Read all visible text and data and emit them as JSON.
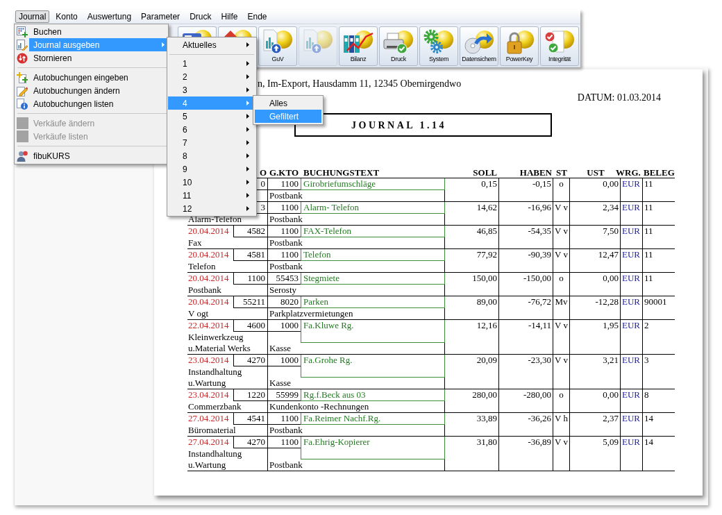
{
  "menubar": {
    "items": [
      {
        "label": "Journal",
        "selected": true
      },
      {
        "label": "Konto",
        "selected": false
      },
      {
        "label": "Auswertung",
        "selected": false
      },
      {
        "label": "Parameter",
        "selected": false
      },
      {
        "label": "Druck",
        "selected": false
      },
      {
        "label": "Hilfe",
        "selected": false
      },
      {
        "label": "Ende",
        "selected": false
      }
    ]
  },
  "toolbar": {
    "buttons": [
      {
        "disabled": false
      },
      {
        "disabled": false
      },
      {
        "label": "GuV",
        "disabled": false
      },
      {
        "disabled": true
      },
      {
        "label": "Bilanz",
        "disabled": false
      },
      {
        "label": "Druck",
        "disabled": false
      },
      {
        "label": "System",
        "disabled": false
      },
      {
        "label": "Datensichern",
        "disabled": false
      },
      {
        "label": "PowerKey",
        "disabled": false
      },
      {
        "label": "Integrität",
        "disabled": false
      }
    ]
  },
  "journal_menu": {
    "groups": [
      [
        {
          "label": "Buchen",
          "selected": false,
          "disabled": false,
          "has_submenu": false
        },
        {
          "label": "Journal ausgeben",
          "selected": true,
          "disabled": false,
          "has_submenu": true
        },
        {
          "label": "Stornieren",
          "selected": false,
          "disabled": false,
          "has_submenu": false
        }
      ],
      [
        {
          "label": "Autobuchungen eingeben",
          "selected": false,
          "disabled": false,
          "has_submenu": false
        },
        {
          "label": "Autobuchungen ändern",
          "selected": false,
          "disabled": false,
          "has_submenu": false
        },
        {
          "label": "Autobuchungen listen",
          "selected": false,
          "disabled": false,
          "has_submenu": false
        }
      ],
      [
        {
          "label": "Verkäufe ändern",
          "selected": false,
          "disabled": true,
          "has_submenu": false
        },
        {
          "label": "Verkäufe listen",
          "selected": false,
          "disabled": true,
          "has_submenu": false
        }
      ],
      [
        {
          "label": "fibuKURS",
          "selected": false,
          "disabled": false,
          "has_submenu": false
        }
      ]
    ]
  },
  "journal_submenu": {
    "groups": [
      [
        {
          "label": "Aktuelles",
          "selected": false,
          "has_submenu": true
        }
      ],
      [
        {
          "label": "1",
          "selected": false,
          "has_submenu": true
        },
        {
          "label": "2",
          "selected": false,
          "has_submenu": true
        },
        {
          "label": "3",
          "selected": false,
          "has_submenu": true
        },
        {
          "label": "4",
          "selected": true,
          "has_submenu": true
        },
        {
          "label": "5",
          "selected": false,
          "has_submenu": true
        },
        {
          "label": "6",
          "selected": false,
          "has_submenu": true
        },
        {
          "label": "7",
          "selected": false,
          "has_submenu": true
        },
        {
          "label": "8",
          "selected": false,
          "has_submenu": true
        },
        {
          "label": "9",
          "selected": false,
          "has_submenu": true
        },
        {
          "label": "10",
          "selected": false,
          "has_submenu": true
        },
        {
          "label": "11",
          "selected": false,
          "has_submenu": true
        },
        {
          "label": "12",
          "selected": false,
          "has_submenu": true
        }
      ]
    ]
  },
  "month_submenu": {
    "items": [
      {
        "label": "Alles",
        "selected": false
      },
      {
        "label": "Gefiltert",
        "selected": true
      }
    ]
  },
  "document": {
    "address": "n, Im-Export, Hausdamm 11, 12345 Obernirgendwo",
    "date": "DATUM: 01.03.2014",
    "title": "JOURNAL 1.14",
    "table": {
      "columns": [
        "O",
        "G.KTO",
        "BUCHUNGSTEXT",
        "SOLL",
        "HABEN",
        "ST",
        "UST",
        "WRG.",
        "BELEG"
      ],
      "rows": [
        {
          "konto": "0",
          "gkto": "1100",
          "buchungstext": "Girobriefumschläge",
          "gkto_name": "Postbank",
          "soll": "0,15",
          "haben": "-0,15",
          "st": "o",
          "ust": "0,00",
          "wrg": "EUR",
          "beleg": "11"
        },
        {
          "konto": "3",
          "gkto": "1100",
          "buchungstext": "Alarm- Telefon",
          "konto_name": "Alarm-Telefon",
          "gkto_name": "Postbank",
          "soll": "14,62",
          "haben": "-16,96",
          "st": "V v",
          "ust": "2,34",
          "wrg": "EUR",
          "beleg": "11"
        },
        {
          "datum": "20.04.2014",
          "konto": "4582",
          "gkto": "1100",
          "buchungstext": "FAX-Telefon",
          "konto_name": "Fax",
          "gkto_name": "Postbank",
          "soll": "46,85",
          "haben": "-54,35",
          "st": "V v",
          "ust": "7,50",
          "wrg": "EUR",
          "beleg": "11"
        },
        {
          "datum": "20.04.2014",
          "konto": "4581",
          "gkto": "1100",
          "buchungstext": "Telefon",
          "konto_name": "Telefon",
          "gkto_name": "Postbank",
          "soll": "77,92",
          "haben": "-90,39",
          "st": "V v",
          "ust": "12,47",
          "wrg": "EUR",
          "beleg": "11"
        },
        {
          "datum": "20.04.2014",
          "konto": "1100",
          "gkto": "55453",
          "buchungstext": "Stegmiete",
          "konto_name": "Postbank",
          "gkto_name": "Serosty",
          "soll": "150,00",
          "haben": "-150,00",
          "st": "o",
          "ust": "0,00",
          "wrg": "EUR",
          "beleg": "11"
        },
        {
          "datum": "20.04.2014",
          "konto": "55211",
          "gkto": "8020",
          "buchungstext": "Parken",
          "konto_name": "V ogt",
          "gkto_name": "Parkplatzvermietungen",
          "soll": "89,00",
          "haben": "-76,72",
          "st": "Mv",
          "ust": "-12,28",
          "wrg": "EUR",
          "beleg": "90001"
        },
        {
          "datum": "22.04.2014",
          "konto": "4600",
          "gkto": "1000",
          "buchungstext": "Fa.Kluwe Rg.",
          "konto_name": "Kleinwerkzeug u.Material Werks",
          "gkto_name": "Kasse",
          "soll": "12,16",
          "haben": "-14,11",
          "st": "V v",
          "ust": "1,95",
          "wrg": "EUR",
          "beleg": "2"
        },
        {
          "datum": "23.04.2014",
          "konto": "4270",
          "gkto": "1000",
          "buchungstext": "Fa.Grohe Rg.",
          "konto_name": "Instandhaltung u.Wartung",
          "gkto_name": "Kasse",
          "soll": "20,09",
          "haben": "-23,30",
          "st": "V v",
          "ust": "3,21",
          "wrg": "EUR",
          "beleg": "3"
        },
        {
          "datum": "23.04.2014",
          "konto": "1220",
          "gkto": "55999",
          "buchungstext": "Rg.f.Beck aus 03",
          "konto_name": "Commerzbank",
          "gkto_name": "Kundenkonto -Rechnungen",
          "soll": "280,00",
          "haben": "-280,00",
          "st": "o",
          "ust": "0,00",
          "wrg": "EUR",
          "beleg": "8"
        },
        {
          "datum": "27.04.2014",
          "konto": "4541",
          "gkto": "1100",
          "buchungstext": "Fa.Reimer Nachf.Rg.",
          "konto_name": "Büromaterial",
          "gkto_name": "Postbank",
          "soll": "33,89",
          "haben": "-36,26",
          "st": "V h",
          "ust": "2,37",
          "wrg": "EUR",
          "beleg": "14"
        },
        {
          "datum": "27.04.2014",
          "konto": "4270",
          "gkto": "1100",
          "buchungstext": "Fa.Ehrig-Kopierer",
          "konto_name": "Instandhaltung u.Wartung",
          "gkto_name": "Postbank",
          "soll": "31,80",
          "haben": "-36,89",
          "st": "V v",
          "ust": "5,09",
          "wrg": "EUR",
          "beleg": "14"
        }
      ]
    }
  }
}
